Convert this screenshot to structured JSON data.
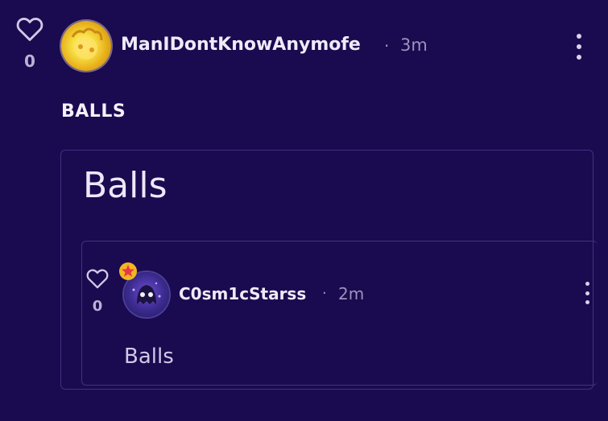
{
  "colors": {
    "background": "#1a0a4f",
    "card_border": "#3f3283",
    "text": "#e8e4f5",
    "muted": "#9b93bd",
    "badge": "#f2b620"
  },
  "post": {
    "like_icon": "heart-outline-icon",
    "like_count": "0",
    "avatar_icon": "yellow-orb-avatar",
    "username": "ManIDontKnowAnymofe",
    "separator": "·",
    "time": "3m",
    "menu_icon": "kebab-menu-icon",
    "title": "BALLS",
    "card": {
      "title": "Balls",
      "reply": {
        "like_icon": "heart-outline-icon",
        "like_count": "0",
        "badge_icon": "star-badge-icon",
        "avatar_icon": "ghost-avatar",
        "username": "C0sm1cStarss",
        "separator": "·",
        "time": "2m",
        "menu_icon": "kebab-menu-icon",
        "text": "Balls"
      }
    }
  }
}
